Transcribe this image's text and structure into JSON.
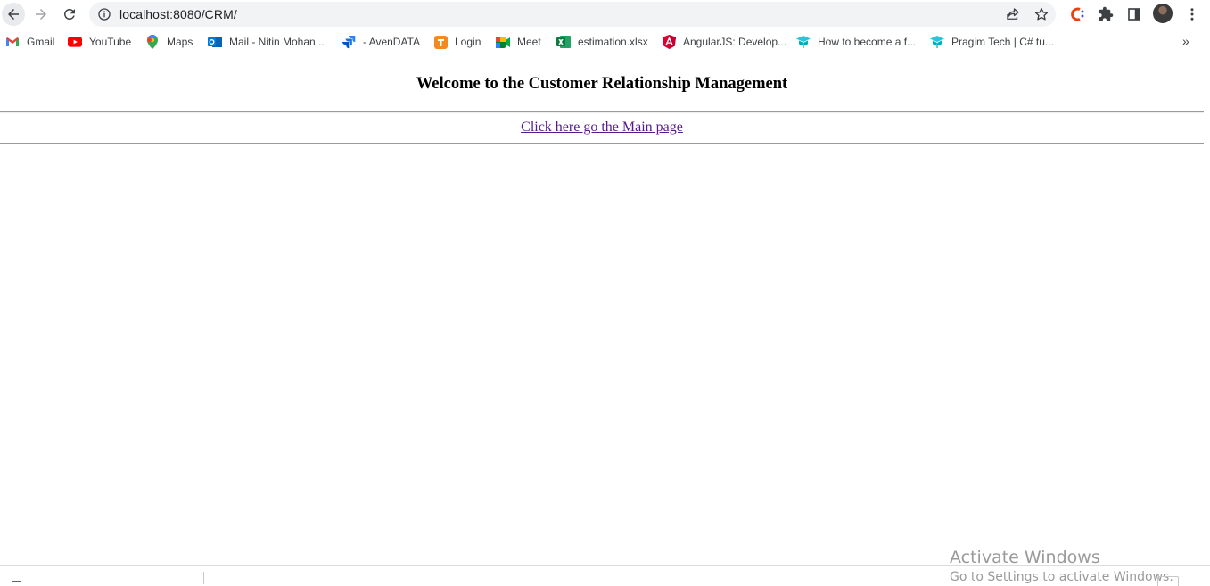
{
  "browser": {
    "url": "localhost:8080/CRM/",
    "bookmarks": [
      {
        "label": "Gmail",
        "icon": "gmail-icon"
      },
      {
        "label": "YouTube",
        "icon": "youtube-icon"
      },
      {
        "label": "Maps",
        "icon": "maps-icon"
      },
      {
        "label": "Mail - Nitin Mohan...",
        "icon": "outlook-icon"
      },
      {
        "label": "- AvenDATA",
        "icon": "jira-icon"
      },
      {
        "label": "Login",
        "icon": "login-icon"
      },
      {
        "label": "Meet",
        "icon": "meet-icon"
      },
      {
        "label": "estimation.xlsx",
        "icon": "excel-icon"
      },
      {
        "label": "AngularJS: Develop...",
        "icon": "angular-icon"
      },
      {
        "label": "How to become a f...",
        "icon": "pragim-icon"
      },
      {
        "label": "Pragim Tech | C# tu...",
        "icon": "pragim-icon"
      }
    ],
    "more_label": "»"
  },
  "page": {
    "title": "Welcome to the Customer Relationship Management",
    "main_link": "Click here go the Main page"
  },
  "watermark": {
    "title": "Activate Windows",
    "subtitle": "Go to Settings to activate Windows."
  },
  "colors": {
    "link": "#551a8b",
    "omnibox": "#f1f3f4"
  }
}
